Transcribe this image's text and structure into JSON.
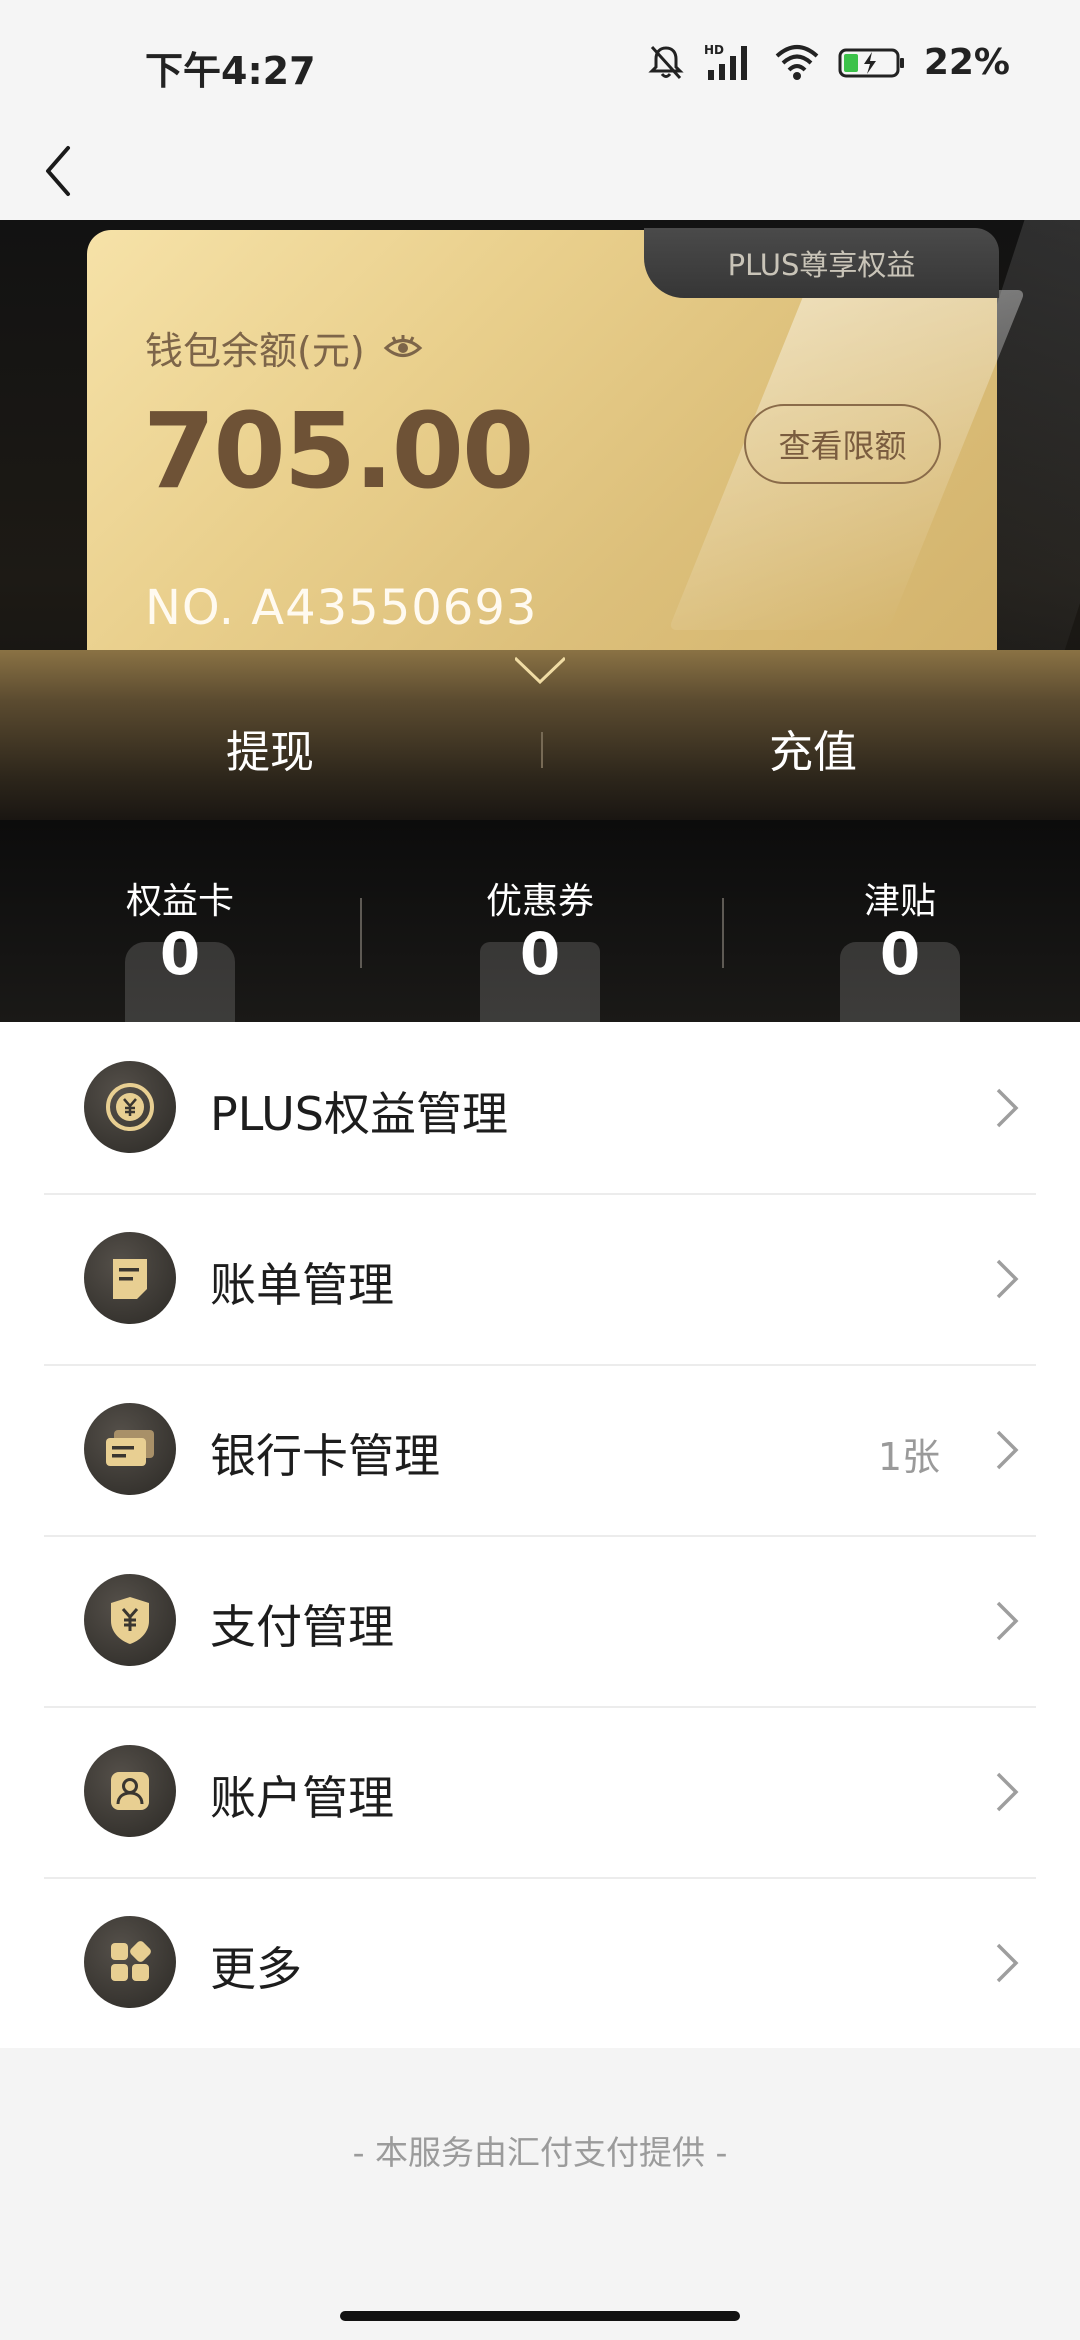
{
  "status_bar": {
    "time": "下午4:27",
    "battery_percent": "22%",
    "network": "HD"
  },
  "nav": {
    "back_icon": "chevron-left-icon"
  },
  "card": {
    "tab_label": "PLUS尊享权益",
    "balance_label": "钱包余额(元)",
    "balance_value": "705.00",
    "limit_button": "查看限额",
    "card_number": "NO. A43550693"
  },
  "actions": {
    "withdraw": "提现",
    "recharge": "充值"
  },
  "stats": [
    {
      "label": "权益卡",
      "value": "0"
    },
    {
      "label": "优惠券",
      "value": "0"
    },
    {
      "label": "津贴",
      "value": "0"
    }
  ],
  "menu": [
    {
      "label": "PLUS权益管理",
      "extra": "",
      "icon": "plus-benefit-icon"
    },
    {
      "label": "账单管理",
      "extra": "",
      "icon": "bill-icon"
    },
    {
      "label": "银行卡管理",
      "extra": "1张",
      "icon": "bank-card-icon"
    },
    {
      "label": "支付管理",
      "extra": "",
      "icon": "payment-shield-icon"
    },
    {
      "label": "账户管理",
      "extra": "",
      "icon": "account-icon"
    },
    {
      "label": "更多",
      "extra": "",
      "icon": "more-grid-icon"
    }
  ],
  "footer": "- 本服务由汇付支付提供 -",
  "colors": {
    "gold": "#e9cf8c",
    "dark": "#121212",
    "balance_text": "#6e5236"
  }
}
